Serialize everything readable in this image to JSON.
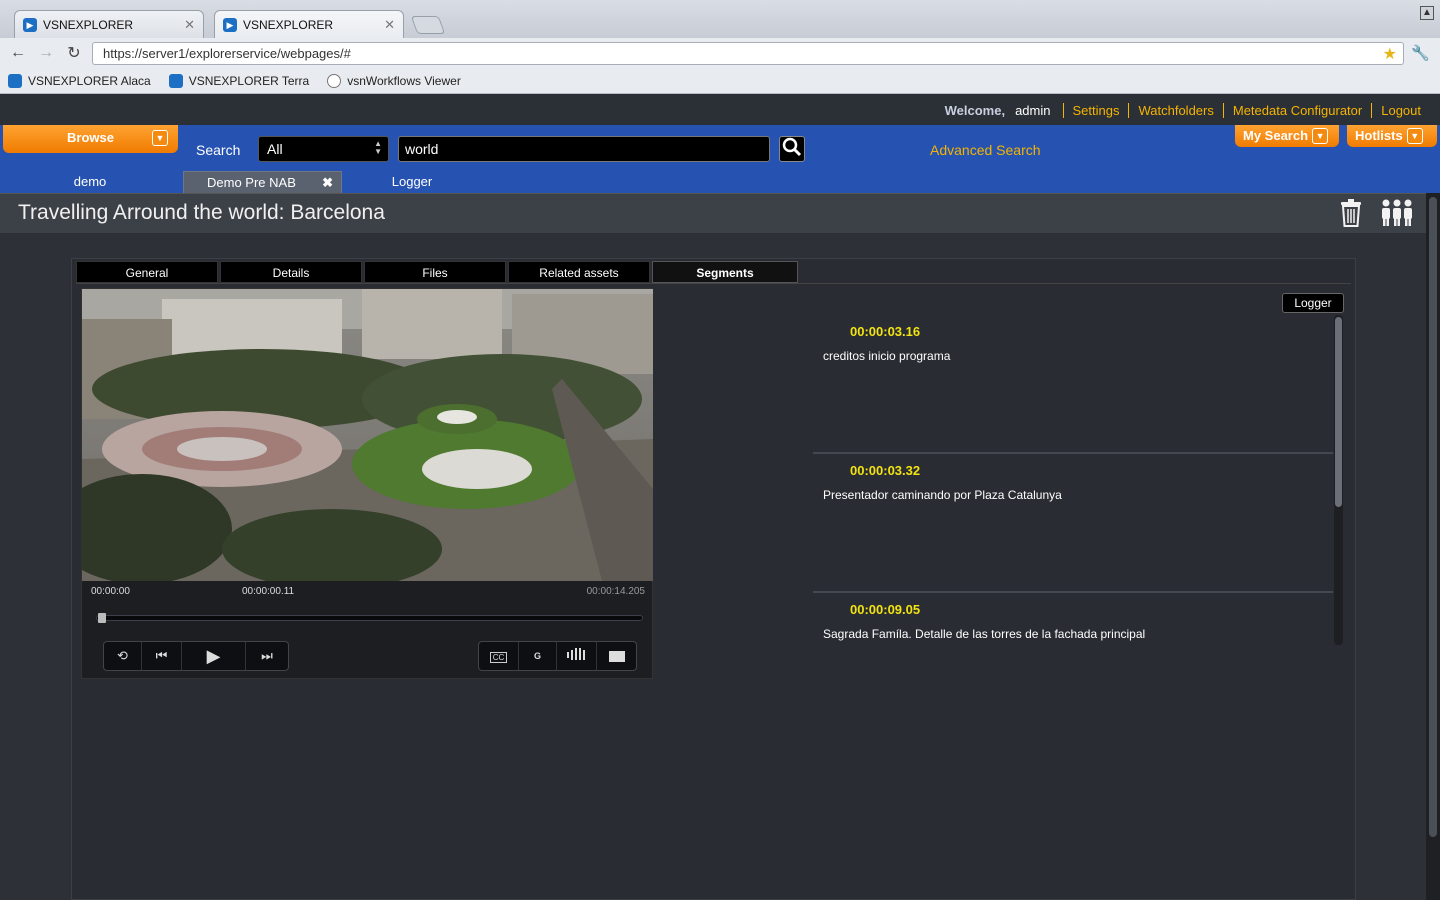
{
  "browser": {
    "tabs": [
      {
        "title": "VSNEXPLORER",
        "active": false
      },
      {
        "title": "VSNEXPLORER",
        "active": true
      }
    ],
    "url": "https://server1/explorerservice/webpages/#",
    "bookmarks": [
      {
        "label": "VSNEXPLORER Alaca",
        "icon": "vsn-favicon"
      },
      {
        "label": "VSNEXPLORER Terra",
        "icon": "vsn-favicon"
      },
      {
        "label": "vsnWorkflows Viewer",
        "icon": "globe-icon"
      }
    ]
  },
  "header": {
    "welcome": "Welcome,",
    "username": "admin",
    "links": [
      "Settings",
      "Watchfolders",
      "Metedata Configurator",
      "Logout"
    ]
  },
  "searchbar": {
    "browse_label": "Browse",
    "search_label": "Search",
    "scope_value": "All",
    "query": "world",
    "advanced_label": "Advanced Search",
    "my_search_label": "My Search",
    "hotlists_label": "Hotlists"
  },
  "workspace_tabs": [
    {
      "label": "demo",
      "active": false
    },
    {
      "label": "Demo Pre NAB",
      "active": true
    },
    {
      "label": "Logger",
      "active": false
    }
  ],
  "asset": {
    "title": "Travelling Arround the world: Barcelona"
  },
  "detail_tabs": [
    {
      "label": "General",
      "active": false
    },
    {
      "label": "Details",
      "active": false
    },
    {
      "label": "Files",
      "active": false
    },
    {
      "label": "Related assets",
      "active": false
    },
    {
      "label": "Segments",
      "active": true
    }
  ],
  "player": {
    "time_start": "00:00:00",
    "time_current": "00:00:00.11",
    "time_end": "00:00:14.205",
    "progress_percent": 0.8,
    "controls_left": [
      "loop-icon",
      "prev-icon",
      "play-icon",
      "next-icon"
    ],
    "controls_right": [
      "CC",
      "G",
      "volume-icon",
      "fullscreen-icon"
    ]
  },
  "segments": {
    "logger_button": "Logger",
    "items": [
      {
        "time": "00:00:03.16",
        "description": "creditos inicio programa"
      },
      {
        "time": "00:00:03.32",
        "description": "Presentador caminando por Plaza Catalunya"
      },
      {
        "time": "00:00:09.05",
        "description": "Sagrada Famíla. Detalle de las torres de la fachada principal"
      }
    ]
  },
  "colors": {
    "accent_orange": "#f07b00",
    "link_yellow": "#f5b400",
    "timecode_yellow": "#f2e311",
    "bar_blue": "#2653b1"
  }
}
